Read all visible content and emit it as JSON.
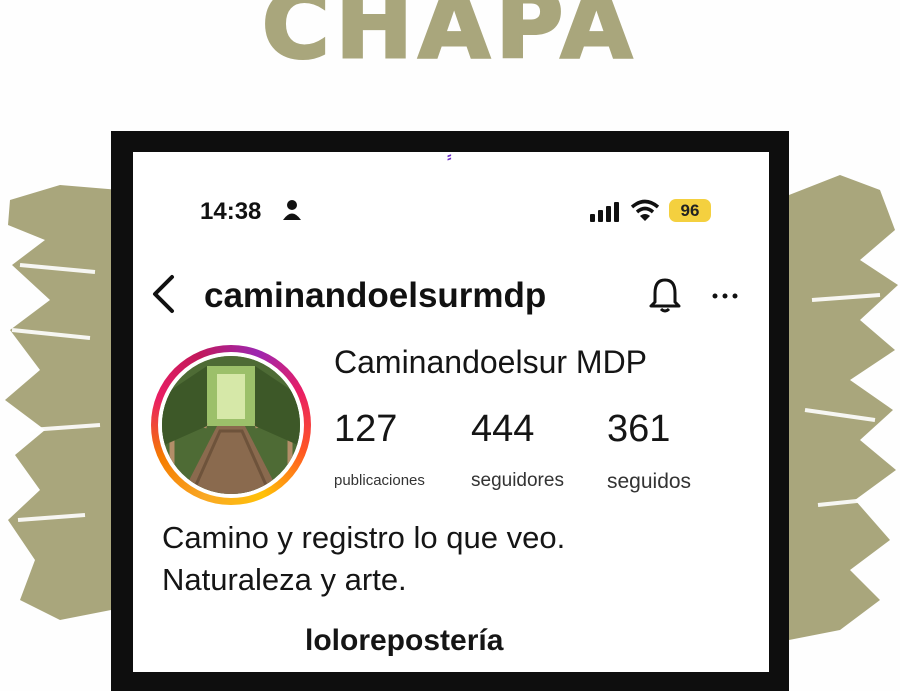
{
  "poster": {
    "title": "CHAPA",
    "accent_color": "#a9a67c"
  },
  "status_bar": {
    "time": "14:38",
    "battery": "96",
    "icons": [
      "person-icon",
      "signal-icon",
      "wifi-icon"
    ]
  },
  "header": {
    "back_icon": "chevron-left-icon",
    "username": "caminandoelsurmdp",
    "bell_icon": "bell-icon",
    "more_icon": "more-horizontal-icon"
  },
  "profile": {
    "display_name": "Caminandoelsur MDP",
    "stats": [
      {
        "value": "127",
        "label": "publicaciones"
      },
      {
        "value": "444",
        "label": "seguidores"
      },
      {
        "value": "361",
        "label": "seguidos"
      }
    ],
    "bio_lines": [
      "Camino y registro lo que veo.",
      "Naturaleza y arte."
    ],
    "link_text": "lolorepostería"
  }
}
